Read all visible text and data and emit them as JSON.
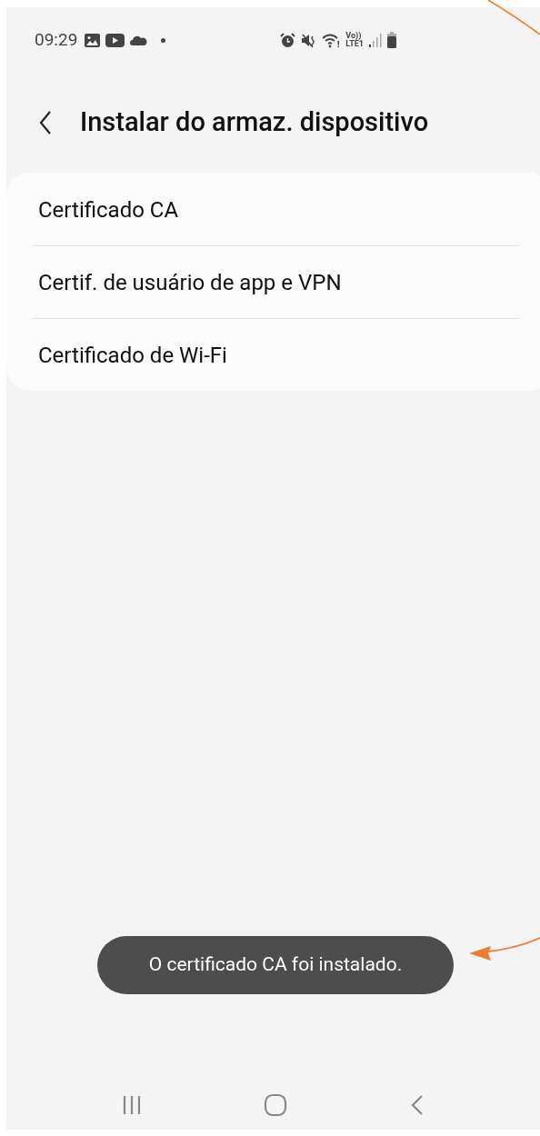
{
  "status_bar": {
    "time": "09:29",
    "volte_label": "Vo))",
    "lte_label": "LTE1"
  },
  "header": {
    "title": "Instalar do armaz. dispositivo"
  },
  "items": [
    {
      "label": "Certificado CA"
    },
    {
      "label": "Certif. de usuário de app e VPN"
    },
    {
      "label": "Certificado de Wi-Fi"
    }
  ],
  "toast": {
    "message": "O certificado CA foi instalado."
  }
}
